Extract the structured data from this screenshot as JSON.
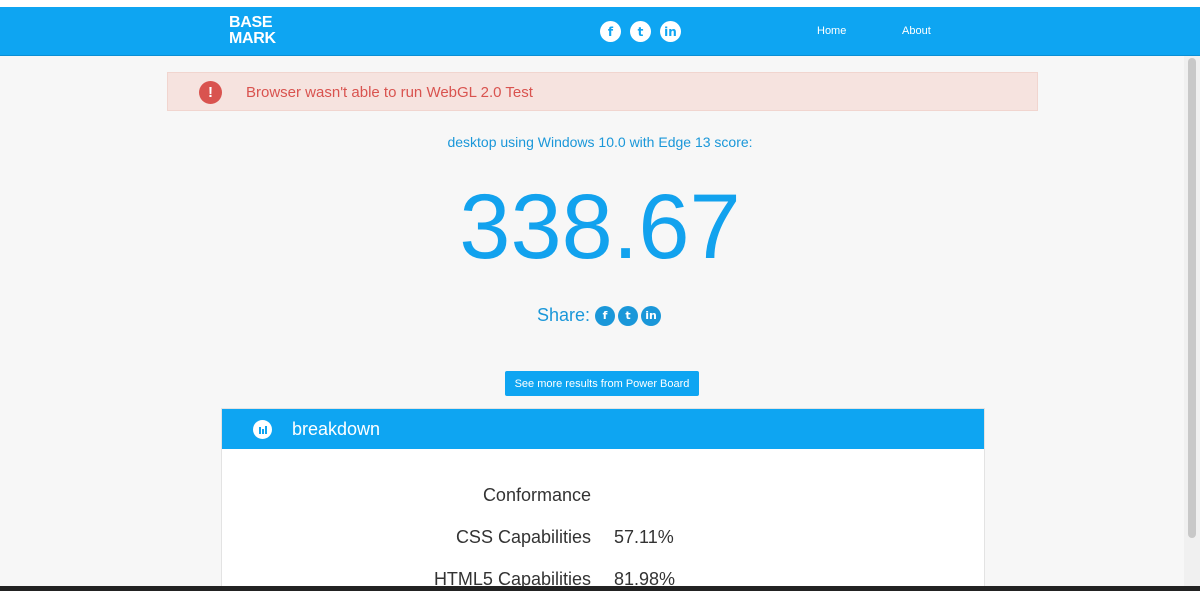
{
  "nav": {
    "logo_line1": "BASE",
    "logo_line2": "MARK",
    "social": [
      "facebook-icon",
      "twitter-icon",
      "linkedin-icon"
    ],
    "home": "Home",
    "about": "About"
  },
  "alert": {
    "icon": "!",
    "text": "Browser wasn't able to run WebGL 2.0 Test"
  },
  "score": {
    "label": "desktop using Windows 10.0 with Edge 13 score:",
    "value": "338.67"
  },
  "share": {
    "label": "Share:"
  },
  "power_board_button": "See more results from Power Board",
  "breakdown": {
    "title": "breakdown",
    "rows": [
      {
        "label": "Conformance",
        "value": ""
      },
      {
        "label": "CSS Capabilities",
        "value": "57.11%"
      },
      {
        "label": "HTML5 Capabilities",
        "value": "81.98%"
      }
    ]
  },
  "colors": {
    "brand_blue": "#0ea5f2",
    "alert_red": "#d9534f",
    "alert_bg": "#f6e3df"
  }
}
